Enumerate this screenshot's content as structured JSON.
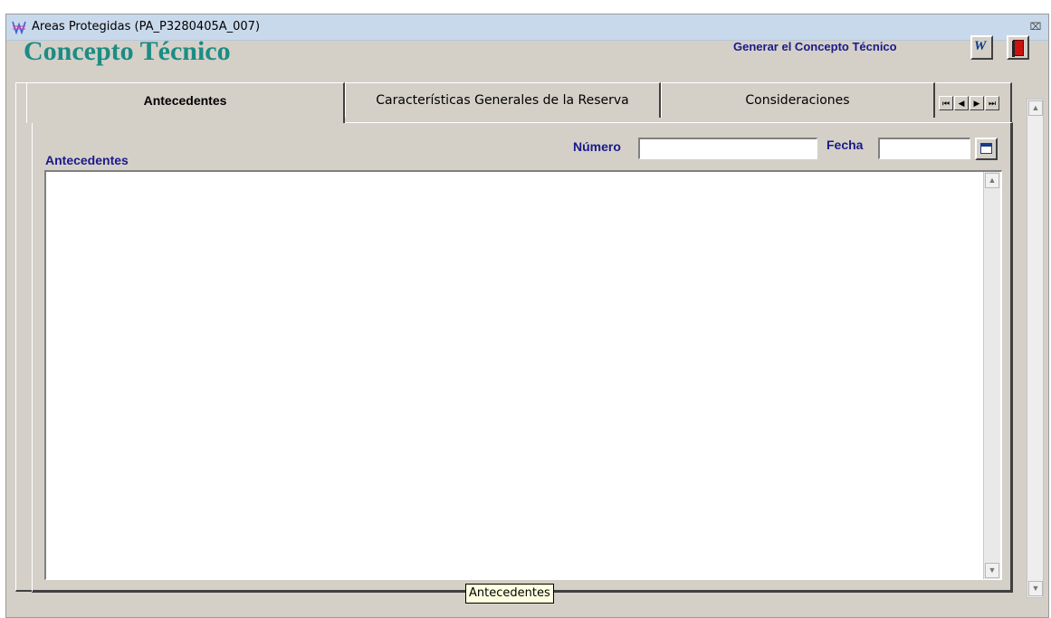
{
  "window": {
    "title": "Areas Protegidas (PA_P3280405A_007)",
    "close_glyph": "⌧",
    "icon": "app-logo-icon"
  },
  "header": {
    "title": "Concepto Técnico",
    "generate_label": "Generar el Concepto Técnico",
    "word_icon_glyph": "W",
    "exit_icon": "exit-door-icon"
  },
  "tabs": [
    {
      "label": "Antecedentes",
      "active": true
    },
    {
      "label": "Características Generales de la Reserva",
      "active": false
    },
    {
      "label": "Consideraciones",
      "active": false
    }
  ],
  "tab_nav": [
    "⏮",
    "◀",
    "▶",
    "⏭"
  ],
  "form": {
    "section_label": "Antecedentes",
    "numero_label": "Número",
    "numero_value": "",
    "fecha_label": "Fecha",
    "fecha_value": "",
    "antecedentes_text": ""
  },
  "tooltip": "Antecedentes",
  "scroll": {
    "up_glyph": "▲",
    "down_glyph": "▼"
  },
  "colors": {
    "heading": "#1c8c84",
    "labels": "#1a1a8a",
    "window_bg": "#d4d0c8",
    "titlebar": "#c9d9ec"
  }
}
